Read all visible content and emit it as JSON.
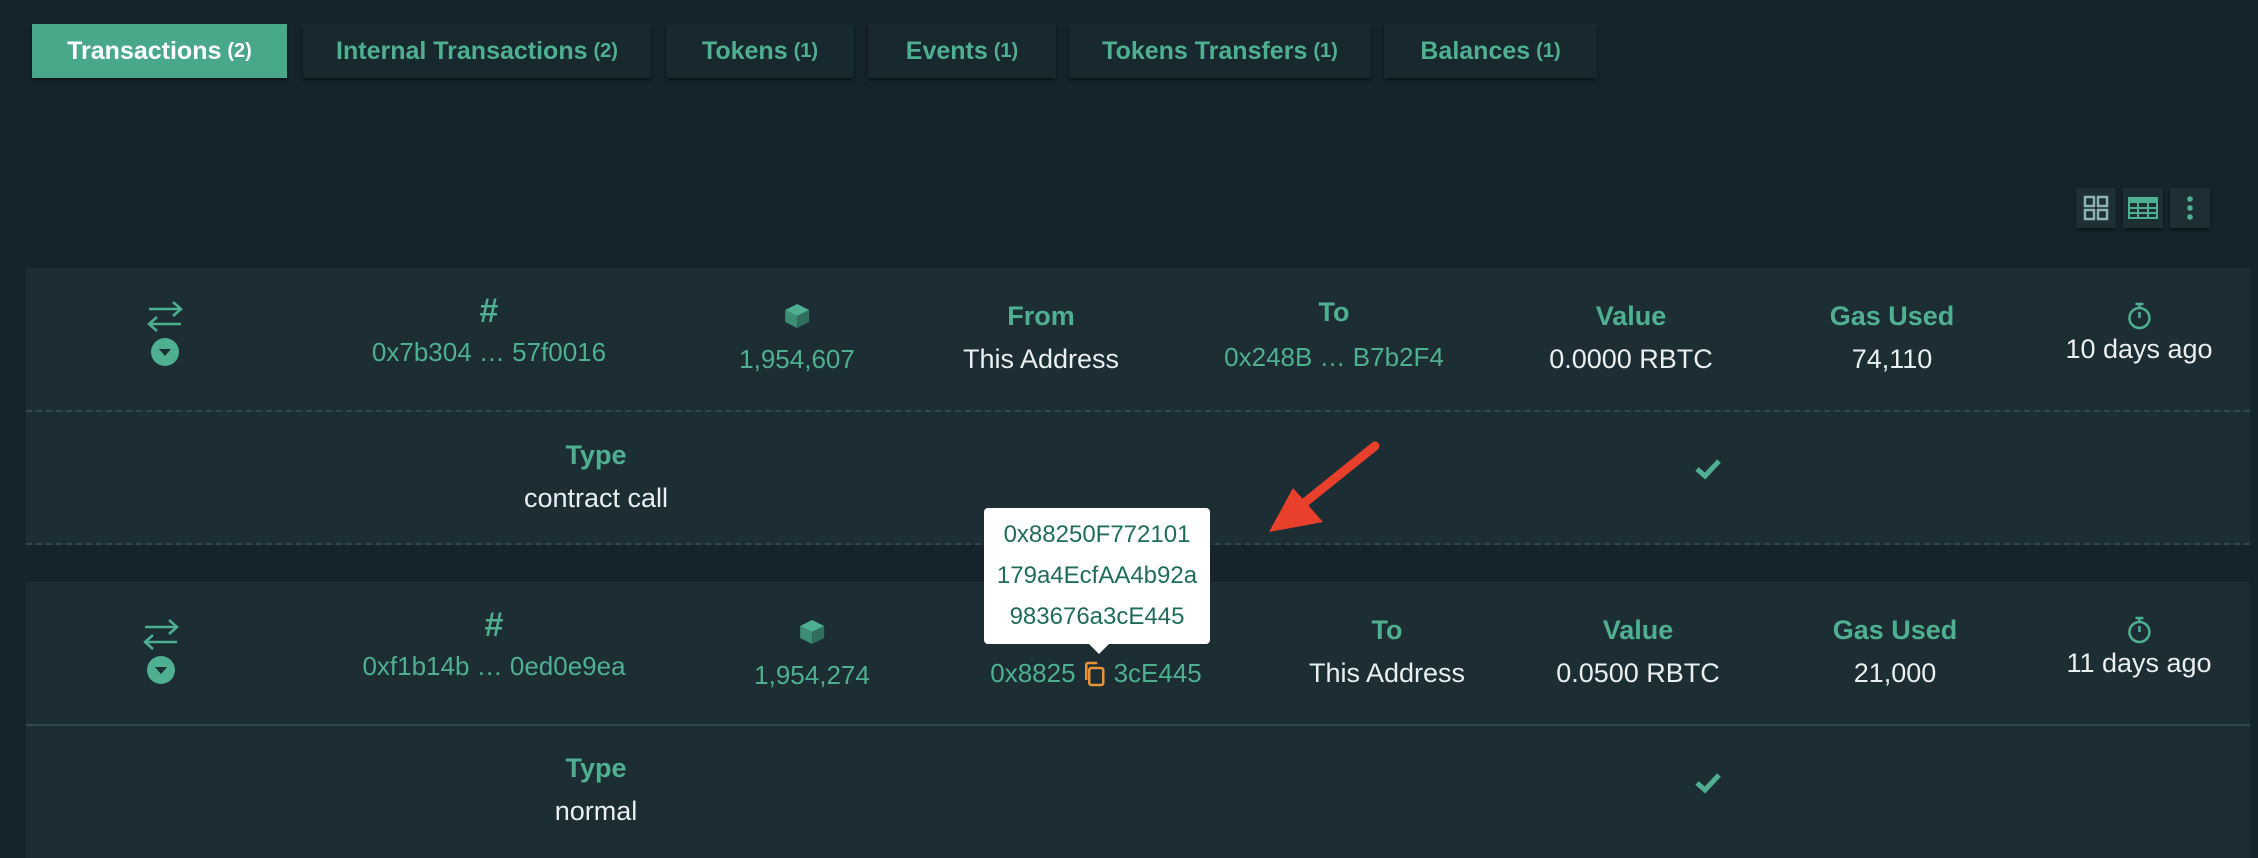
{
  "tabs": [
    {
      "label": "Transactions",
      "count": "(2)"
    },
    {
      "label": "Internal Transactions",
      "count": "(2)"
    },
    {
      "label": "Tokens",
      "count": "(1)"
    },
    {
      "label": "Events",
      "count": "(1)"
    },
    {
      "label": "Tokens Transfers",
      "count": "(1)"
    },
    {
      "label": "Balances",
      "count": "(1)"
    }
  ],
  "active_tab": "Transactions",
  "view_controls": [
    "grid-view-icon",
    "table-view-icon",
    "more-options-icon"
  ],
  "transactions": [
    {
      "hash_label": "#",
      "hash": "0x7b304 … 57f0016",
      "block": "1,954,607",
      "from_label": "From",
      "from": "This Address",
      "to_label": "To",
      "to": "0x248B … B7b2F4",
      "value_label": "Value",
      "value": "0.0000 RBTC",
      "gas_label": "Gas Used",
      "gas": "74,110",
      "time": "10 days ago",
      "type_label": "Type",
      "type": "contract call",
      "status": "success"
    },
    {
      "hash_label": "#",
      "hash": "0xf1b14b … 0ed0e9ea",
      "block": "1,954,274",
      "from_start": "0x8825",
      "from_end": "3cE445",
      "to_label": "To",
      "to": "This Address",
      "value_label": "Value",
      "value": "0.0500 RBTC",
      "gas_label": "Gas Used",
      "gas": "21,000",
      "time": "11 days ago",
      "type_label": "Type",
      "type": "normal",
      "status": "success"
    }
  ],
  "tooltip": {
    "lines": [
      "0x88250F772101",
      "179a4EcfAA4b92a",
      "983676a3cE445"
    ]
  },
  "colors": {
    "background": "#15232b",
    "card": "#1c2d34",
    "accent": "#4fb091",
    "active_tab": "#4aa88a",
    "copy_icon": "#e8923a",
    "annotation_arrow": "#e8402b"
  }
}
